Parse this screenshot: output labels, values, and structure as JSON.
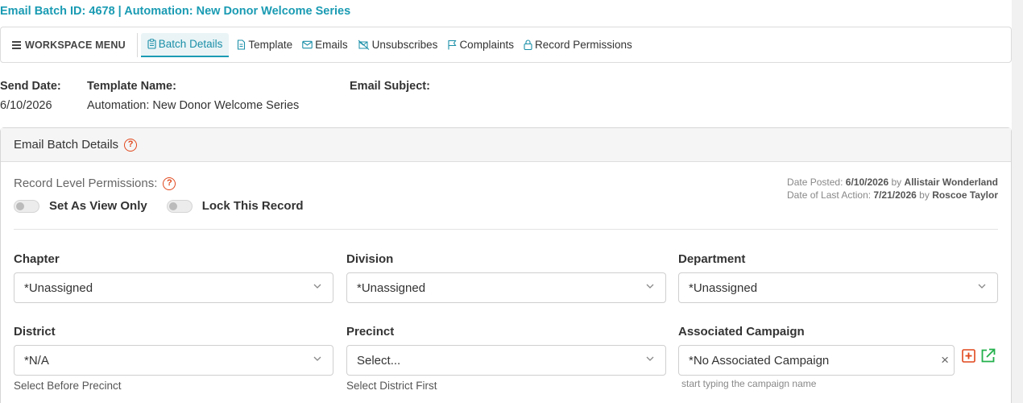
{
  "header": {
    "title": "Email Batch ID: 4678 | Automation: New Donor Welcome Series"
  },
  "workspace": {
    "menu_label": "WORKSPACE MENU",
    "tabs": [
      {
        "label": "Batch Details",
        "icon": "clipboard-icon",
        "active": true
      },
      {
        "label": "Template",
        "icon": "document-icon",
        "active": false
      },
      {
        "label": "Emails",
        "icon": "envelope-icon",
        "active": false
      },
      {
        "label": "Unsubscribes",
        "icon": "unsubscribe-icon",
        "active": false
      },
      {
        "label": "Complaints",
        "icon": "flag-icon",
        "active": false
      },
      {
        "label": "Record Permissions",
        "icon": "lock-icon",
        "active": false
      }
    ]
  },
  "info": {
    "send_date_label": "Send Date:",
    "send_date_value": "6/10/2026",
    "template_name_label": "Template Name:",
    "template_name_value": "Automation: New Donor Welcome Series",
    "email_subject_label": "Email Subject:",
    "email_subject_value": ""
  },
  "card": {
    "title": "Email Batch Details",
    "help_glyph": "?",
    "permissions_label": "Record Level Permissions:",
    "toggle_view_only_label": "Set As View Only",
    "toggle_view_only_on": false,
    "toggle_lock_label": "Lock This Record",
    "toggle_lock_on": false,
    "meta": {
      "posted_label": "Date Posted:",
      "posted_date": "6/10/2026",
      "posted_by_word": "by",
      "posted_by": "Allistair Wonderland",
      "last_action_label": "Date of Last Action:",
      "last_action_date": "7/21/2026",
      "last_action_by_word": "by",
      "last_action_by": "Roscoe Taylor"
    }
  },
  "fields": {
    "chapter": {
      "label": "Chapter",
      "value": "*Unassigned"
    },
    "division": {
      "label": "Division",
      "value": "*Unassigned"
    },
    "department": {
      "label": "Department",
      "value": "*Unassigned"
    },
    "district": {
      "label": "District",
      "value": "*N/A",
      "hint": "Select Before Precinct"
    },
    "precinct": {
      "label": "Precinct",
      "value": "Select...",
      "hint": "Select District First"
    },
    "campaign": {
      "label": "Associated Campaign",
      "value": "*No Associated Campaign",
      "hint": "start typing the campaign name",
      "clear_glyph": "×"
    }
  },
  "colors": {
    "accent": "#1a9bb3",
    "help": "#e0471c",
    "add": "#e0471c",
    "open": "#22b04b"
  }
}
